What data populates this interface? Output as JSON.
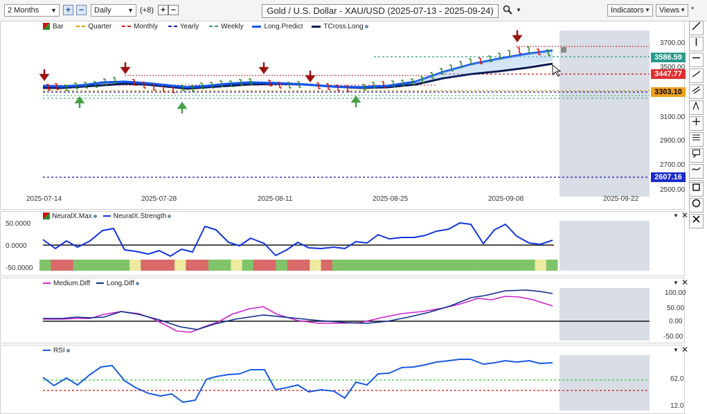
{
  "toolbar": {
    "period": "2 Months",
    "interval": "Daily",
    "plus_count": "(+8)",
    "title": "Gold / U.S. Dollar - XAU/USD (2025-07-13 - 2025-09-24)",
    "indicators_label": "Indicators",
    "views_label": "Views",
    "star": "*"
  },
  "price_panel": {
    "legend": [
      {
        "label": "Bar",
        "color": "#2a8a2a"
      },
      {
        "label": "Quarter",
        "color": "#d49a00"
      },
      {
        "label": "Monthly",
        "color": "#cc1111"
      },
      {
        "label": "Yearly",
        "color": "#1111aa"
      },
      {
        "label": "Weekly",
        "color": "#2a9a55"
      },
      {
        "label": "Long.Predict",
        "color": "#1155ee"
      },
      {
        "label": "TCross.Long",
        "color": "#0a1a55"
      }
    ],
    "y_ticks": [
      "3700.00",
      "3500.00",
      "3100.00",
      "2900.00",
      "2700.00",
      "2500.00"
    ],
    "x_ticks": [
      "2025-07-14",
      "2025-07-28",
      "2025-08-11",
      "2025-08-25",
      "2025-09-08",
      "2025-09-22"
    ],
    "price_tags": [
      {
        "value": "3586.59",
        "bg": "#2a9a8c",
        "color": "#ffffff"
      },
      {
        "value": "3447.77",
        "bg": "#e03030",
        "color": "#ffffff"
      },
      {
        "value": "3303.10",
        "bg": "#f0a020",
        "color": "#000000"
      },
      {
        "value": "2607.16",
        "bg": "#1a2acc",
        "color": "#ffffff"
      }
    ]
  },
  "neural_panel": {
    "legend": [
      "NeuralX.Max",
      "NeuralX.Strength"
    ],
    "y_ticks": [
      "50.0000",
      "0.0000",
      "-50.0000"
    ],
    "strength_color": "#1033dd",
    "bar_colors": {
      "green": "#7fc46a",
      "red": "#d86a6a",
      "yellow": "#eeeaa0"
    },
    "max_bars": [
      "g",
      "r",
      "r",
      "g",
      "g",
      "g",
      "g",
      "g",
      "y",
      "r",
      "r",
      "r",
      "y",
      "r",
      "r",
      "g",
      "g",
      "y",
      "g",
      "r",
      "r",
      "g",
      "r",
      "r",
      "y",
      "r",
      "g",
      "g",
      "g",
      "g",
      "g",
      "g",
      "g",
      "g",
      "g",
      "g",
      "g",
      "g",
      "g",
      "g",
      "g",
      "g",
      "g",
      "g",
      "y",
      "g"
    ]
  },
  "diff_panel": {
    "legend": [
      "Medium.Diff",
      "Long.Diff"
    ],
    "y_ticks": [
      "100.00",
      "50.00",
      "0.00",
      "-50.00"
    ],
    "medium_color": "#cc22cc",
    "long_color": "#0a2a88"
  },
  "rsi_panel": {
    "legend": [
      "RSI"
    ],
    "y_ticks": [
      "62.0",
      "12.0"
    ],
    "rsi_color": "#1a5ae0"
  }
}
